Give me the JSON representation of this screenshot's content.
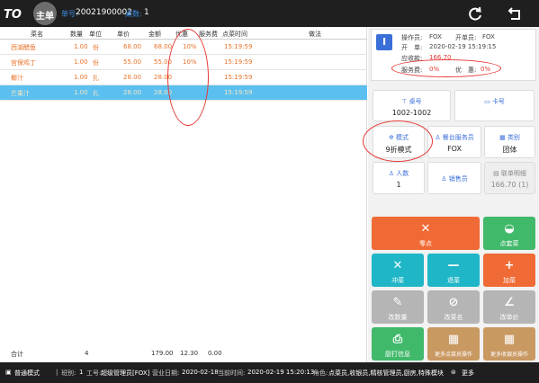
{
  "topbar": {
    "app_title": "主单",
    "order_label": "单号:",
    "order_no": "20021900002",
    "table_count_label": "桌数:",
    "table_count": "1",
    "refresh_icon": "refresh-icon",
    "back_icon": "back-icon"
  },
  "table": {
    "headers": [
      "菜名",
      "数量",
      "单位",
      "单价",
      "金额",
      "优惠",
      "服务费",
      "点菜时间",
      "做法"
    ],
    "rows": [
      {
        "name": "西湖醋鱼",
        "qty": "1.00",
        "unit": "份",
        "price": "68.00",
        "amount": "68.00",
        "discount": "10%",
        "service": "",
        "time": "15:19:59",
        "method": ""
      },
      {
        "name": "宫保鸡丁",
        "qty": "1.00",
        "unit": "份",
        "price": "55.00",
        "amount": "55.00",
        "discount": "10%",
        "service": "",
        "time": "15:19:59",
        "method": ""
      },
      {
        "name": "椰汁",
        "qty": "1.00",
        "unit": "扎",
        "price": "28.00",
        "amount": "28.00",
        "discount": "",
        "service": "",
        "time": "15:19:59",
        "method": ""
      },
      {
        "name": "芒果汁",
        "qty": "1.00",
        "unit": "扎",
        "price": "28.00",
        "amount": "28.00",
        "discount": "",
        "service": "",
        "time": "15:19:59",
        "method": ""
      }
    ],
    "selected_row": 3,
    "total": {
      "label": "合计",
      "qty": "4",
      "amount": "179.00",
      "discount": "12.30",
      "service": "0.00"
    }
  },
  "info": {
    "icon_letter": "I",
    "operator_label": "操作员:",
    "operator": "FOX",
    "opener_label": "开单员:",
    "opener": "FOX",
    "open_label": "开　单:",
    "open_time": "2020-02-19 15:19:15",
    "due_label": "应收款:",
    "due": "166.70",
    "service_label": "服务费:",
    "service": "0%",
    "discount_label": "优　惠:",
    "discount": "0%"
  },
  "cards": {
    "table_no": {
      "label": "桌号",
      "value": "1002-1002",
      "icon": "table-icon"
    },
    "card_no": {
      "label": "卡号",
      "value": "",
      "icon": "card-icon"
    },
    "mode": {
      "label": "模式",
      "value": "9折模式",
      "icon": "gear-icon"
    },
    "waiter": {
      "label": "餐台服务员",
      "value": "FOX",
      "icon": "user-icon"
    },
    "category": {
      "label": "类别",
      "value": "团体",
      "icon": "grid-icon"
    },
    "people": {
      "label": "人数",
      "value": "1",
      "icon": "people-icon"
    },
    "sales": {
      "label": "销售员",
      "value": "",
      "icon": "user-icon"
    },
    "bill_detail": {
      "label": "联单明细",
      "value": "166.70 (1)",
      "icon": "document-icon"
    }
  },
  "buttons": {
    "order_item": "零点",
    "order_set": "点套菜",
    "void_item": "冲菜",
    "return_item": "退菜",
    "add_item": "加菜",
    "change_qty": "改数量",
    "change_name": "改菜名",
    "change_price": "改单价",
    "reprint": "厨打信息",
    "more_dish_ops": "更多点菜员操作",
    "more_cashier_ops": "更多收银员操作"
  },
  "status": {
    "mode": "普通模式",
    "shift_label": "班别:",
    "shift": "1",
    "emp_label": "工号:",
    "emp": "超级管理员[FOX]",
    "biz_date_label": "营业日期:",
    "biz_date": "2020-02-18",
    "cur_time_label": "当前时间:",
    "cur_time": "2020-02-19 15:20:13",
    "role_label": "角色:",
    "roles": "点菜员,收银员,精核管理员,厨房,特殊模块",
    "more": "更多"
  },
  "colors": {
    "accent_blue": "#3a6fd8",
    "order_orange": "#e8732a",
    "selected_row": "#5bc0f0",
    "annotation_red": "#e53935"
  }
}
